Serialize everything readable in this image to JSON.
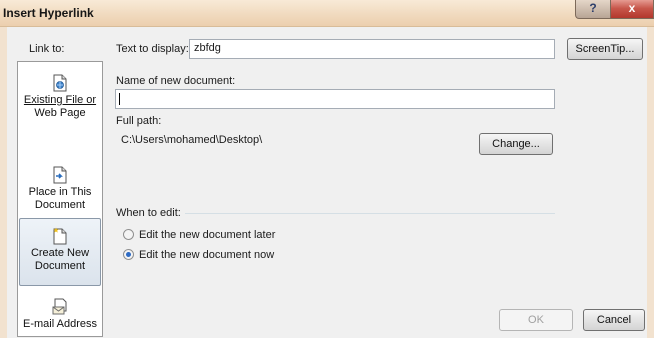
{
  "window": {
    "title": "Insert Hyperlink",
    "help_label": "?",
    "close_label": "x"
  },
  "link_to": {
    "label": "Link to:",
    "items": [
      {
        "line1": "Existing File or",
        "line2": "Web Page",
        "icon": "existing-file-icon",
        "selected": false
      },
      {
        "line1": "Place in This",
        "line2": "Document",
        "icon": "place-in-document-icon",
        "selected": false
      },
      {
        "line1": "Create New",
        "line2": "Document",
        "icon": "new-document-icon",
        "selected": true
      },
      {
        "line1": "E-mail Address",
        "line2": "",
        "icon": "email-icon",
        "selected": false
      }
    ]
  },
  "text_to_display": {
    "label": "Text to display:",
    "value": "zbfdg"
  },
  "screentip_label": "ScreenTip...",
  "new_document": {
    "label": "Name of new document:",
    "value": ""
  },
  "full_path": {
    "label": "Full path:",
    "value": "C:\\Users\\mohamed\\Desktop\\"
  },
  "change_label": "Change...",
  "when_to_edit": {
    "label": "When to edit:",
    "options": [
      {
        "label": "Edit the new document later",
        "checked": false
      },
      {
        "label": "Edit the new document now",
        "checked": true
      }
    ]
  },
  "ok_label": "OK",
  "cancel_label": "Cancel",
  "colors": {
    "window_frame": "#f2e2cf",
    "dialog_bg": "#f0f0f0",
    "radio_selected": "#2e6bc4"
  }
}
